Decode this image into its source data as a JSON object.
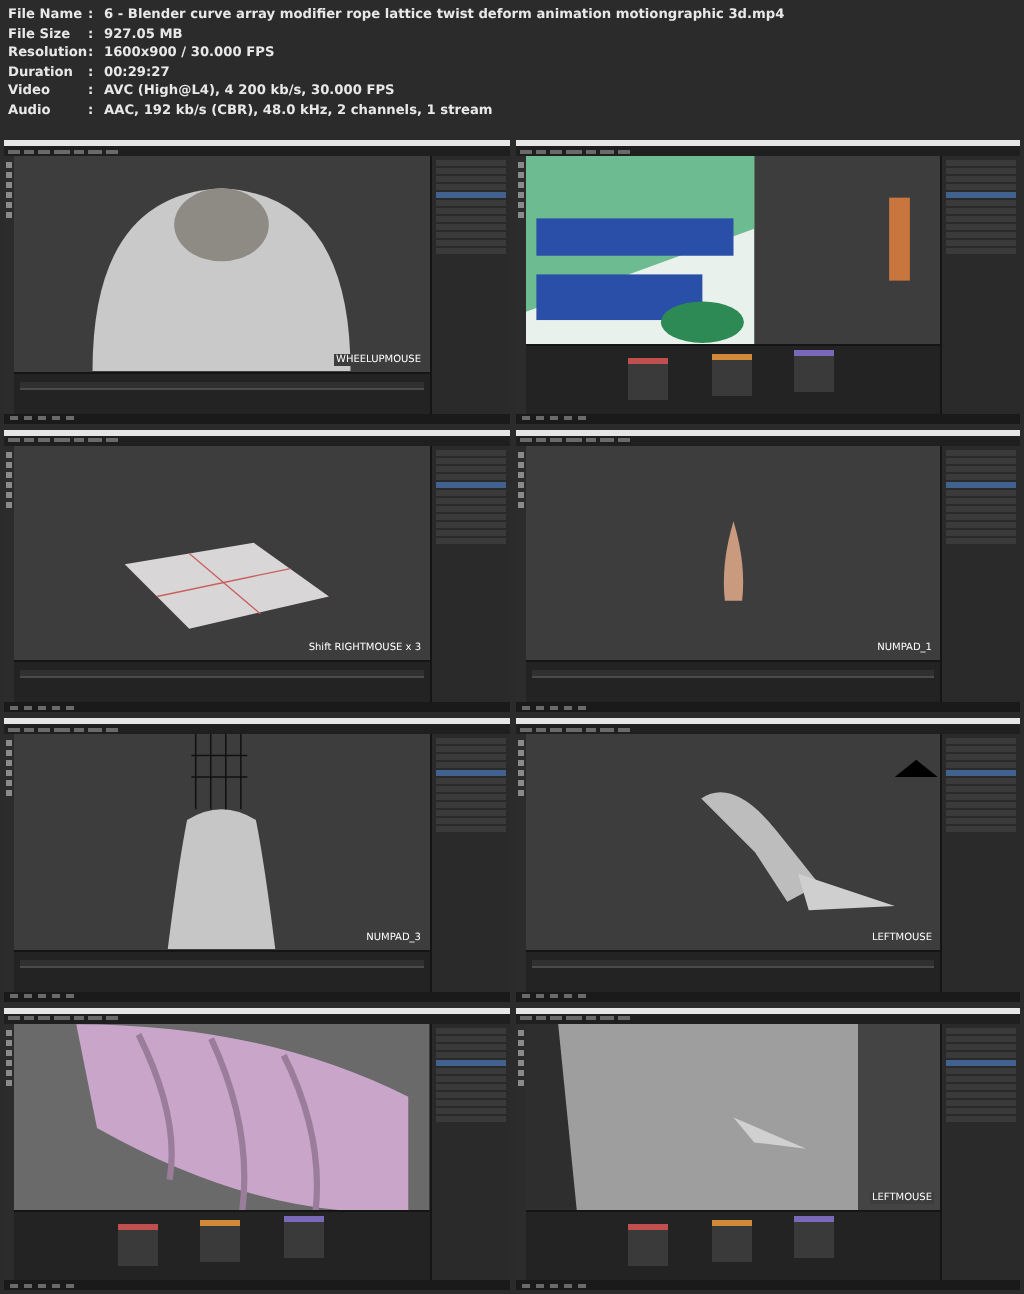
{
  "info": [
    {
      "label": "File Name",
      "value": "6 - Blender curve array modifier rope lattice twist deform animation motiongraphic 3d.mp4"
    },
    {
      "label": "File Size",
      "value": "927.05 MB"
    },
    {
      "label": "Resolution",
      "value": "1600x900 / 30.000 FPS"
    },
    {
      "label": "Duration",
      "value": "00:29:27"
    },
    {
      "label": "Video",
      "value": "AVC (High@L4), 4 200 kb/s, 30.000 FPS"
    },
    {
      "label": "Audio",
      "value": "AAC, 192 kb/s (CBR), 48.0 kHz, 2 channels, 1 stream"
    }
  ],
  "separator": ":",
  "frames": [
    {
      "kind": "dome",
      "key": "WHEELUPMOUSE"
    },
    {
      "kind": "texture"
    },
    {
      "kind": "plane",
      "key": "Shift RIGHTMOUSE x 3"
    },
    {
      "kind": "cone",
      "key": "NUMPAD_1"
    },
    {
      "kind": "bell",
      "key": "NUMPAD_3"
    },
    {
      "kind": "rope",
      "key": "LEFTMOUSE"
    },
    {
      "kind": "twist"
    },
    {
      "kind": "studio",
      "key": "LEFTMOUSE"
    }
  ]
}
